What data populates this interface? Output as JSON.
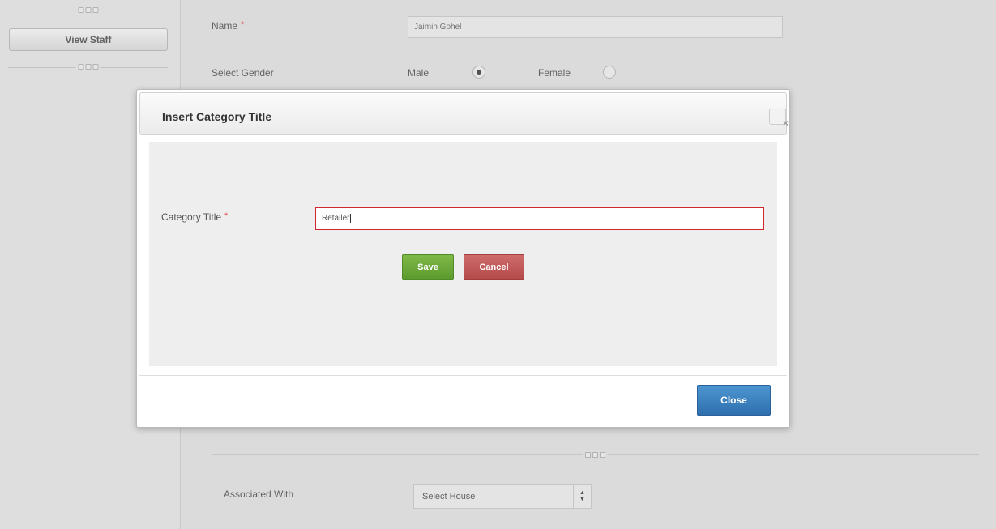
{
  "sidebar": {
    "view_staff_label": "View Staff"
  },
  "form": {
    "name_label": "Name",
    "name_value": "Jaimin Gohel",
    "required_mark": "*",
    "gender_label": "Select Gender",
    "gender_male": "Male",
    "gender_female": "Female",
    "gender_selected": "Male",
    "associated_label": "Associated With",
    "associated_value": "Select House",
    "select_arrow_up": "▲",
    "select_arrow_down": "▼"
  },
  "modal": {
    "title": "Insert Category Title",
    "close_glyph": "×",
    "category_label": "Category Title",
    "required_mark": "*",
    "category_value": "Retailer",
    "save_label": "Save",
    "cancel_label": "Cancel",
    "close_label": "Close"
  },
  "colors": {
    "save": "#5a9a2c",
    "cancel": "#b44a4a",
    "close": "#2f6fae",
    "error_border": "#d0262d"
  }
}
